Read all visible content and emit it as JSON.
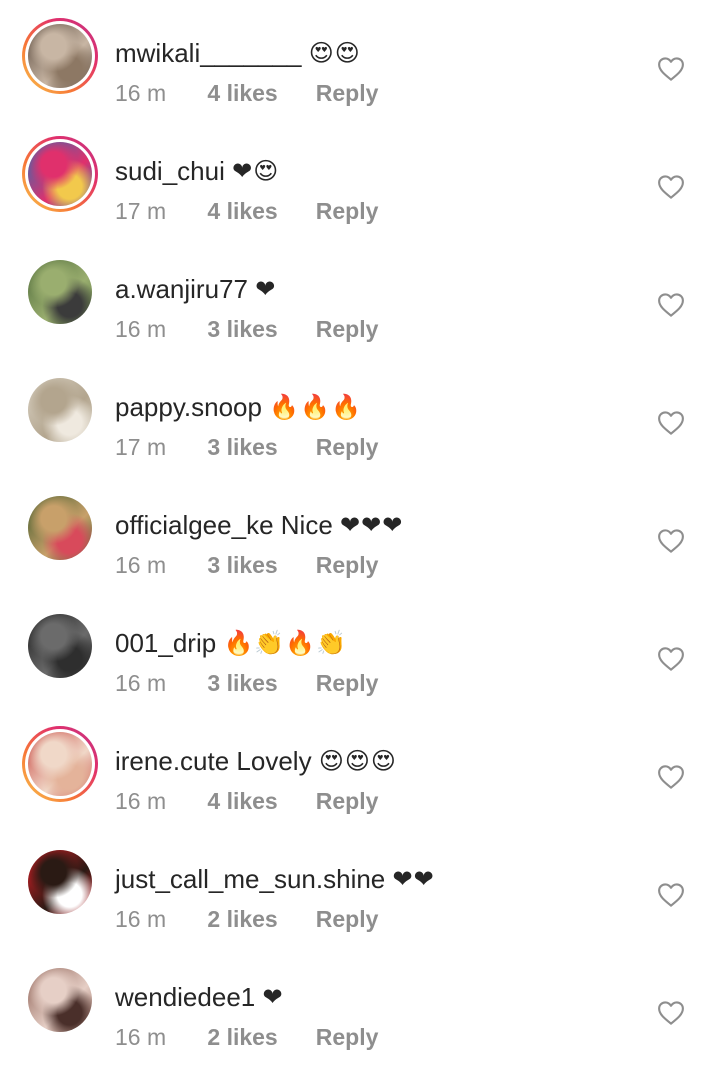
{
  "comments": [
    {
      "username": "mwikali_______",
      "body": "",
      "emoji": "😍😍",
      "time": "16 m",
      "likes": "4 likes",
      "reply": "Reply",
      "story": true,
      "avatar_colors": [
        "#5a4a3e",
        "#c8b6a4",
        "#8d7864"
      ]
    },
    {
      "username": "sudi_chui",
      "body": "",
      "emoji": "❤😍",
      "time": "17 m",
      "likes": "4 likes",
      "reply": "Reply",
      "story": true,
      "avatar_colors": [
        "#2a6fb5",
        "#e0306c",
        "#f2c94c"
      ]
    },
    {
      "username": "a.wanjiru77",
      "body": "",
      "emoji": "❤",
      "time": "16 m",
      "likes": "3 likes",
      "reply": "Reply",
      "story": false,
      "avatar_colors": [
        "#4f6b3a",
        "#9aae6f",
        "#3b3b3b"
      ]
    },
    {
      "username": "pappy.snoop",
      "body": "",
      "emoji": "🔥🔥🔥",
      "time": "17 m",
      "likes": "3 likes",
      "reply": "Reply",
      "story": false,
      "avatar_colors": [
        "#d9d2c4",
        "#b3a58e",
        "#efe9df"
      ]
    },
    {
      "username": "officialgee_ke",
      "body": "Nice",
      "emoji": "❤❤❤",
      "time": "16 m",
      "likes": "3 likes",
      "reply": "Reply",
      "story": false,
      "avatar_colors": [
        "#3d5a2a",
        "#c8a06a",
        "#d84a5b"
      ]
    },
    {
      "username": "001_drip",
      "body": "",
      "emoji": "🔥👏🔥👏",
      "time": "16 m",
      "likes": "3 likes",
      "reply": "Reply",
      "story": false,
      "avatar_colors": [
        "#1c1c1c",
        "#6b6b6b",
        "#2e2e2e"
      ]
    },
    {
      "username": "irene.cute",
      "body": "Lovely",
      "emoji": "😍😍😍",
      "time": "16 m",
      "likes": "4 likes",
      "reply": "Reply",
      "story": true,
      "avatar_colors": [
        "#c7443e",
        "#f0d8c8",
        "#e4b39a"
      ]
    },
    {
      "username": "just_call_me_sun.shine",
      "body": "",
      "emoji": "❤❤",
      "time": "16 m",
      "likes": "2 likes",
      "reply": "Reply",
      "story": false,
      "avatar_colors": [
        "#e01e26",
        "#2a1a14",
        "#ffffff"
      ]
    },
    {
      "username": "wendiedee1",
      "body": "",
      "emoji": "❤",
      "time": "16 m",
      "likes": "2 likes",
      "reply": "Reply",
      "story": false,
      "avatar_colors": [
        "#8b5e52",
        "#e6cfc6",
        "#4a2f2a"
      ]
    }
  ],
  "colors": {
    "username": "#262626",
    "meta": "#8e8e8e",
    "heart_outline": "#8e8e8e"
  },
  "icons": {
    "like": "heart-outline-icon"
  }
}
